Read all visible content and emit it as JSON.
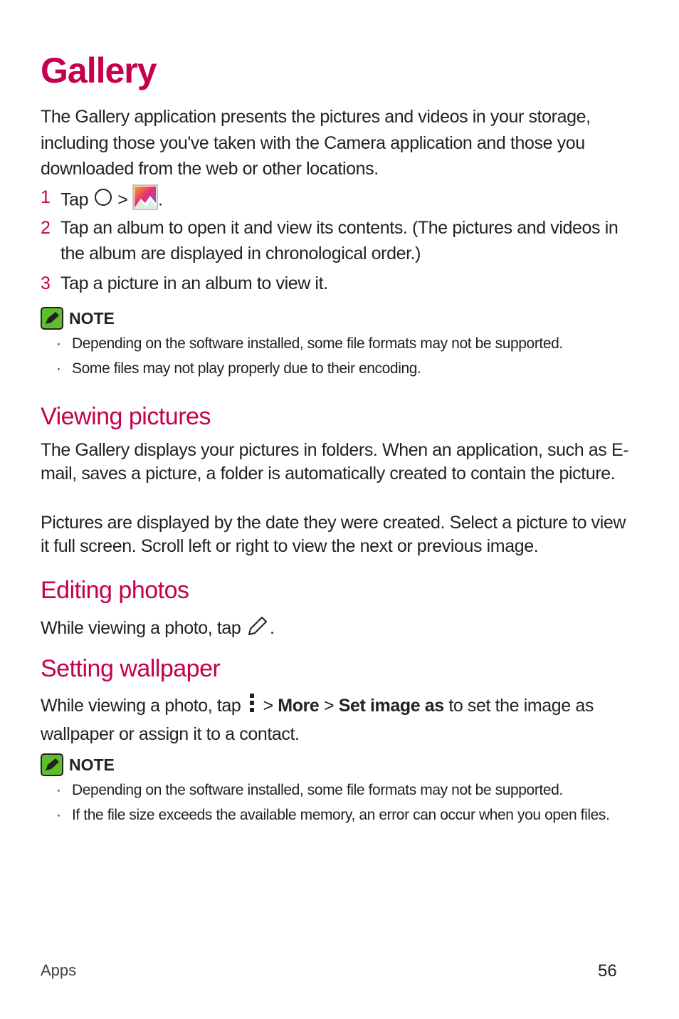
{
  "title": "Gallery",
  "intro": "The Gallery application presents the pictures and videos in your storage, including those you've taken with the Camera application and those you downloaded from the web or other locations.",
  "steps": [
    {
      "num": "1",
      "pre": "Tap",
      "sep": ">",
      "post": ".",
      "icons": [
        "home-circle-icon",
        "gallery-app-icon"
      ]
    },
    {
      "num": "2",
      "text": "Tap an album to open it and view its contents. (The pictures and videos in the album are displayed in chronological order.)"
    },
    {
      "num": "3",
      "text": "Tap a picture in an album to view it."
    }
  ],
  "note1": {
    "label": "NOTE",
    "bullets": [
      "Depending on the software installed, some file formats may not be supported.",
      "Some files may not play properly due to their encoding."
    ]
  },
  "viewing": {
    "heading": "Viewing pictures",
    "p1": "The Gallery displays your pictures in folders. When an application, such as E-mail, saves a picture, a folder is automatically created to contain the picture.",
    "p2": "Pictures are displayed by the date they were created. Select a picture to view it full screen. Scroll left or right to view the next or previous image."
  },
  "editing": {
    "heading": "Editing photos",
    "pre": "While viewing a photo, tap",
    "post": "."
  },
  "wallpaper": {
    "heading": "Setting wallpaper",
    "pre": "While viewing a photo, tap",
    "sep": ">",
    "more": "More",
    "set_image_as": "Set image as",
    "post": "to set the image as wallpaper or assign it to a contact."
  },
  "note2": {
    "label": "NOTE",
    "bullets": [
      "Depending on the software installed, some file formats may not be supported.",
      "If the file size exceeds the available memory, an error can occur when you open files."
    ]
  },
  "footer": {
    "section": "Apps",
    "page": "56"
  },
  "bullet_char": "·",
  "colors": {
    "accent": "#c5004f",
    "note_green": "#5fbf2a"
  }
}
